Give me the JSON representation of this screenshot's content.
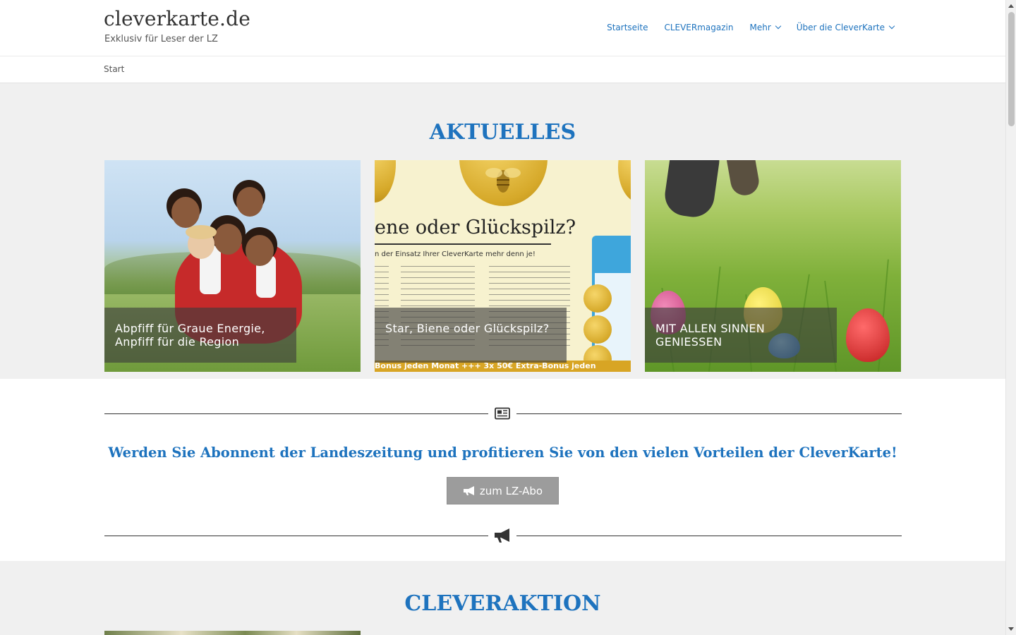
{
  "site": {
    "title": "cleverkarte.de",
    "tagline": "Exklusiv für Leser der LZ"
  },
  "nav": {
    "items": [
      {
        "label": "Startseite",
        "has_dropdown": false
      },
      {
        "label": "CLEVERmagazin",
        "has_dropdown": false
      },
      {
        "label": "Mehr",
        "has_dropdown": true
      },
      {
        "label": "Über die CleverKarte",
        "has_dropdown": true
      }
    ]
  },
  "breadcrumb": {
    "current": "Start"
  },
  "aktuelles": {
    "heading": "AKTUELLES",
    "cards": [
      {
        "caption": "Abpfiff für Graue Energie, Anpfiff für die Region"
      },
      {
        "caption": "Star, Biene oder Glückspilz?",
        "image_text": {
          "title": "ene oder Glückspilz?",
          "subtitle": "n der Einsatz Ihrer CleverKarte mehr denn je!",
          "band": "Bonus jeden Monat +++ 3x 50€ Extra-Bonus jeden"
        }
      },
      {
        "caption": "MIT ALLEN SINNEN GENIESSEN"
      }
    ]
  },
  "abo": {
    "promo_text": "Werden Sie Abonnent der Landeszeitung und profitieren Sie von den vielen Vorteilen der CleverKarte!",
    "button_label": "zum LZ-Abo"
  },
  "cleveraktion": {
    "heading": "CLEVERAKTION"
  },
  "colors": {
    "accent": "#1e73be",
    "section_gray": "#f0f0f0",
    "button_gray": "#9c9c9c"
  },
  "icons": {
    "top_divider": "newspaper-icon",
    "bottom_divider": "megaphone-icon",
    "button": "bullhorn-icon"
  }
}
